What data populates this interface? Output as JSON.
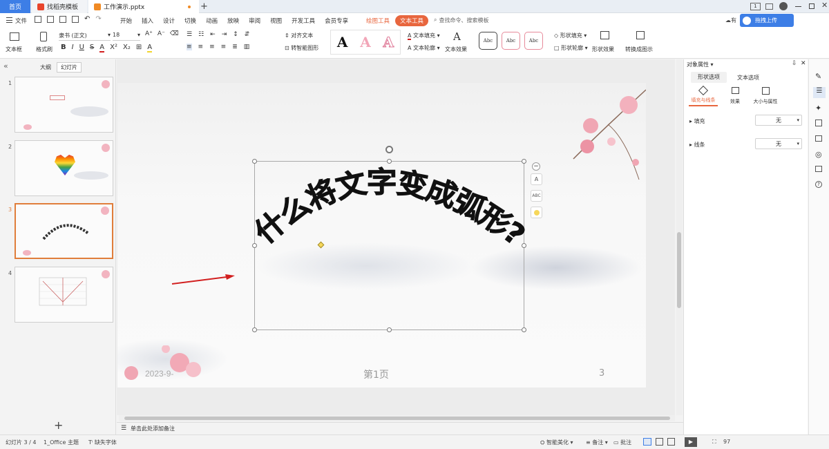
{
  "tabs": {
    "home": "首页",
    "template_tab": "找稻壳模板",
    "doc_tab": "工作演示.pptx",
    "new_tab": "+"
  },
  "window": {
    "badge": "1",
    "cloud_label": "有",
    "upload_button": "拖拽上传"
  },
  "menu": {
    "file": "文件",
    "items": [
      "开始",
      "插入",
      "设计",
      "切换",
      "动画",
      "放映",
      "审阅",
      "视图",
      "开发工具",
      "会员专享"
    ],
    "draw_tools": "绘图工具",
    "text_tools": "文本工具",
    "search_placeholder": "查找命令、搜索模板"
  },
  "ribbon": {
    "textbox": "文本框",
    "format_painter": "格式刷",
    "font_name": "隶书 (正文)",
    "font_size": "18",
    "align_text": "对齐文本",
    "smart_shape": "转智能图形",
    "text_fill": "文本填充",
    "text_outline": "文本轮廓",
    "text_effect": "文本效果",
    "style_sample": "Abc",
    "shape_fill": "形状填充",
    "shape_outline": "形状轮廓",
    "shape_effect": "形状效果",
    "convert_graphic": "转换成图示",
    "wordart_letter": "A"
  },
  "left_panel": {
    "outline_tab": "大纲",
    "slides_tab": "幻灯片",
    "add_button": "+"
  },
  "thumbnails": [
    {
      "num": "1"
    },
    {
      "num": "2"
    },
    {
      "num": "3"
    },
    {
      "num": "4"
    }
  ],
  "slide": {
    "arc_text": "什么将文字变成弧形?",
    "date": "2023-9-",
    "page_label": "第1页",
    "page_number": "3"
  },
  "notes": {
    "placeholder": "单击此处添加备注"
  },
  "right_panel": {
    "title": "对象属性",
    "tab_shape": "形状选项",
    "tab_text": "文本选项",
    "sub_fill": "填充与线条",
    "sub_effect": "效果",
    "sub_size": "大小与属性",
    "fill_label": "填充",
    "fill_value": "无",
    "line_label": "线条",
    "line_value": "无"
  },
  "status": {
    "slide_info": "幻灯片 3 / 4",
    "theme": "1_Office 主题",
    "missing_font": "缺失字体",
    "smart_beautify": "智能美化",
    "notes": "备注",
    "comments": "批注",
    "zoom": "97"
  },
  "colors": {
    "accent": "#e8663e",
    "tab_blue": "#3d7ee6",
    "selection": "#e07d3a",
    "arrow": "#d21f1f"
  }
}
